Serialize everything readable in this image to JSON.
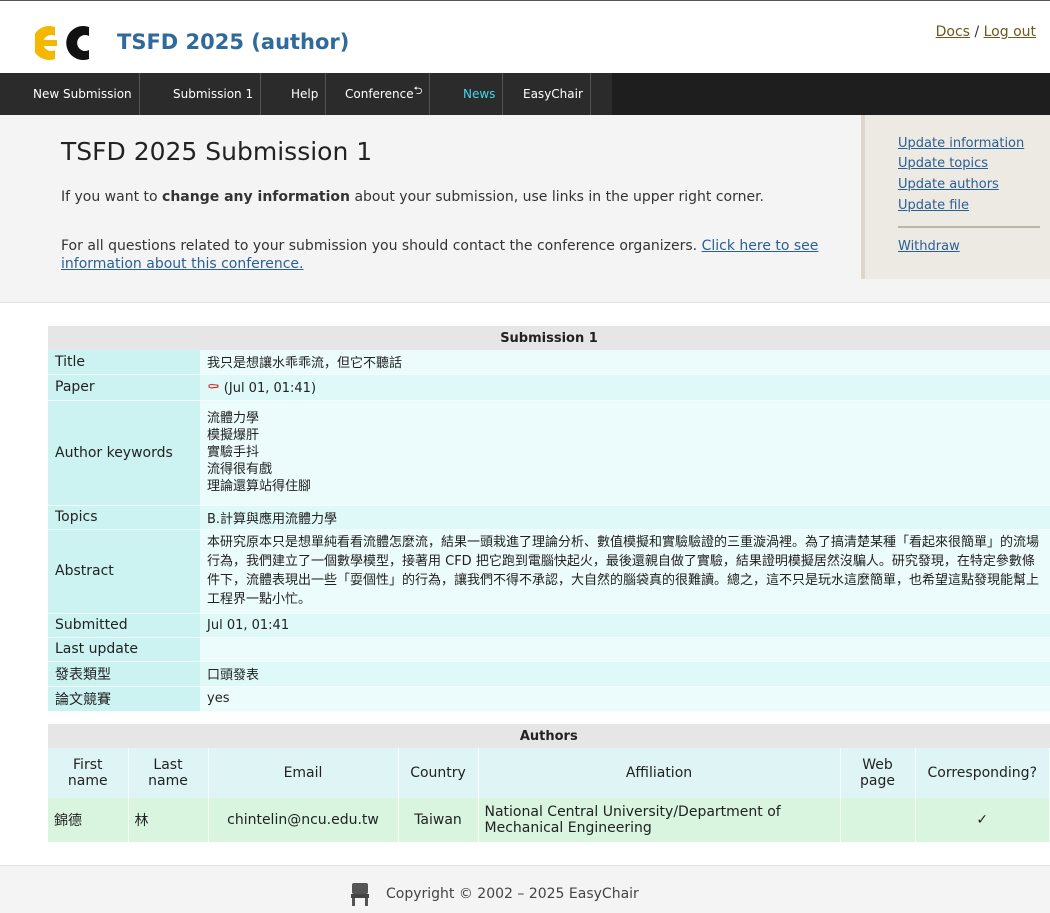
{
  "header": {
    "app_title": "TSFD 2025 (author)",
    "docs_link": "Docs",
    "separator": "/",
    "logout_link": "Log out"
  },
  "nav": [
    {
      "label": "New Submission"
    },
    {
      "label": "Submission 1"
    },
    {
      "label": "Help"
    },
    {
      "label": "Conference"
    },
    {
      "label": "News"
    },
    {
      "label": "EasyChair"
    }
  ],
  "page": {
    "title": "TSFD 2025 Submission 1",
    "p1_a": "If you want to ",
    "p1_bold": "change any information",
    "p1_b": " about your submission, use links in the upper right corner.",
    "p2_a": "For all questions related to your submission you should contact the conference organizers. ",
    "p2_link": "Click here to see information about this conference."
  },
  "sidebar": {
    "update_information": "Update information",
    "update_topics": "Update topics",
    "update_authors": "Update authors",
    "update_file": "Update file",
    "withdraw": "Withdraw"
  },
  "submission": {
    "caption": "Submission 1",
    "title_label": "Title",
    "title_value": "我只是想讓水乖乖流，但它不聽話",
    "paper_label": "Paper",
    "paper_value": "(Jul 01, 01:41)",
    "keywords_label": "Author keywords",
    "keywords": [
      "流體力學",
      "模擬爆肝",
      "實驗手抖",
      "流得很有戲",
      "理論還算站得住腳"
    ],
    "topics_label": "Topics",
    "topics_value": "B.計算與應用流體力學",
    "abstract_label": "Abstract",
    "abstract_value": "本研究原本只是想單純看看流體怎麼流，結果一頭栽進了理論分析、數值模擬和實驗驗證的三重漩渦裡。為了搞清楚某種「看起來很簡單」的流場行為，我們建立了一個數學模型，接著用 CFD 把它跑到電腦快起火，最後還親自做了實驗，結果證明模擬居然沒騙人。研究發現，在特定參數條件下，流體表現出一些「耍個性」的行為，讓我們不得不承認，大自然的腦袋真的很難讀。總之，這不只是玩水這麼簡單，也希望這點發現能幫上工程界一點小忙。",
    "submitted_label": "Submitted",
    "submitted_value": "Jul 01, 01:41",
    "last_update_label": "Last update",
    "last_update_value": "",
    "presentation_label": "發表類型",
    "presentation_value": "口頭發表",
    "competition_label": "論文競賽",
    "competition_value": "yes"
  },
  "authors": {
    "caption": "Authors",
    "headers": [
      "First name",
      "Last name",
      "Email",
      "Country",
      "Affiliation",
      "Web page",
      "Corresponding?"
    ],
    "rows": [
      {
        "first": "錦德",
        "last": "林",
        "email": "chintelin@ncu.edu.tw",
        "country": "Taiwan",
        "affiliation": "National Central University/Department of Mechanical Engineering",
        "web": "",
        "corresponding": "✓"
      }
    ]
  },
  "footer": {
    "copyright": "Copyright © 2002 – 2025 EasyChair"
  },
  "colors": {
    "nav_bg": "#2b2b2b",
    "news": "#45d6f0",
    "title_blue": "#2f6a9b",
    "link_blue": "#2a5f95",
    "logo_yellow": "#f5b800"
  }
}
